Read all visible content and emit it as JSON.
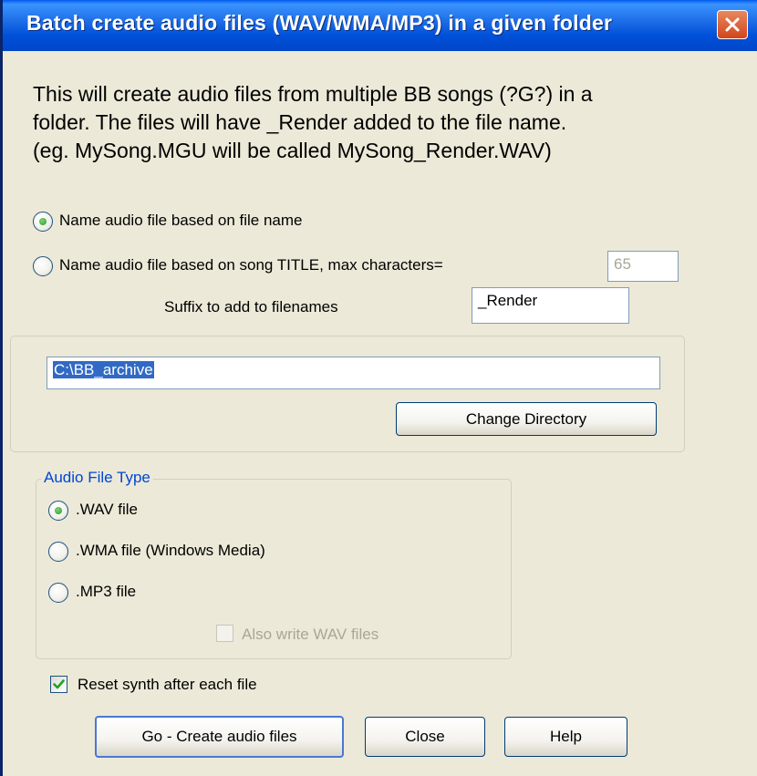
{
  "window": {
    "title": "Batch create audio files (WAV/WMA/MP3) in a given folder"
  },
  "description": {
    "line1": "This will create audio files from multiple BB songs (?G?) in a",
    "line2": "folder.  The files will have _Render added to the file name.",
    "line3": "(eg. MySong.MGU will be called MySong_Render.WAV)"
  },
  "naming": {
    "option_file_name": "Name audio file based on file name",
    "option_song_title": "Name audio file based on song TITLE, max characters=",
    "selected": "option_file_name",
    "max_characters": "65",
    "suffix_label": "Suffix to add to filenames",
    "suffix_value": "_Render"
  },
  "directory": {
    "path": "C:\\BB_archive",
    "change_button": "Change Directory"
  },
  "audio_type": {
    "legend": "Audio File Type",
    "options": [
      {
        "label": ".WAV file",
        "selected": true
      },
      {
        "label": ".WMA file (Windows Media)",
        "selected": false
      },
      {
        "label": ".MP3 file",
        "selected": false
      }
    ],
    "also_write_wav": {
      "label": "Also write WAV files",
      "checked": false,
      "enabled": false
    }
  },
  "reset_synth": {
    "label": "Reset synth after each file",
    "checked": true
  },
  "buttons": {
    "go": "Go - Create audio files",
    "close": "Close",
    "help": "Help"
  },
  "colors": {
    "titlebar": "#0054e3",
    "dialog_bg": "#ece9d8",
    "group_legend": "#0046d5",
    "close_button": "#d2451c",
    "selection": "#316ac5",
    "radio_dot": "#21a121"
  }
}
